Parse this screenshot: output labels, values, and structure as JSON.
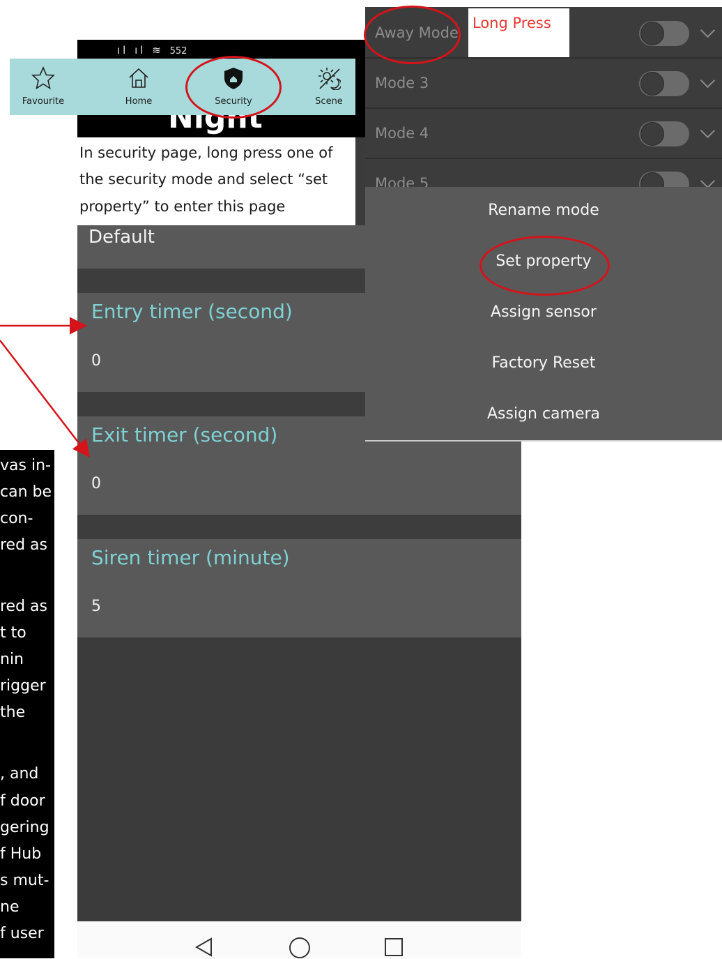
{
  "left_note": {
    "lines": [
      "vas in-",
      "can be",
      "con-",
      "red as",
      "",
      "red as",
      "t to",
      "nin",
      "rigger",
      "the",
      "",
      ", and",
      "f door",
      "gering",
      "f Hub",
      "s mut-",
      "ne",
      "f user"
    ]
  },
  "status_bar": {
    "signal_text": "ıl ıl ≋",
    "number": "552"
  },
  "bottom_tabs": [
    {
      "label": "Favourite",
      "icon": "star-icon"
    },
    {
      "label": "Home",
      "icon": "home-icon"
    },
    {
      "label": "Security",
      "icon": "shield-icon"
    },
    {
      "label": "Scene",
      "icon": "scene-icon"
    }
  ],
  "page_title": "Night mode",
  "caption": {
    "lines": [
      "In security page, long press one of",
      "the security mode and select “set",
      "property” to enter this page"
    ]
  },
  "property_page": {
    "default_label": "Default",
    "fields": [
      {
        "title": "Entry timer (second)",
        "value": "0"
      },
      {
        "title": "Exit timer (second)",
        "value": "0"
      },
      {
        "title": "Siren timer (minute)",
        "value": "5"
      }
    ]
  },
  "mode_list": {
    "modes": [
      {
        "label": "Away Mode",
        "enabled": false
      },
      {
        "label": "Mode 3",
        "enabled": false
      },
      {
        "label": "Mode 4",
        "enabled": false
      },
      {
        "label": "Mode 5",
        "enabled": false
      }
    ],
    "annotation": "Long Press"
  },
  "context_menu": {
    "items": [
      "Rename mode",
      "Set property",
      "Assign sensor",
      "Factory Reset",
      "Assign camera"
    ]
  },
  "colors": {
    "accent_teal": "#7fd2d4",
    "nav_bar": "#a8dadb",
    "annotation_red": "#d5131a",
    "panel_dark": "#3c3c3c",
    "panel_light": "#595959"
  }
}
